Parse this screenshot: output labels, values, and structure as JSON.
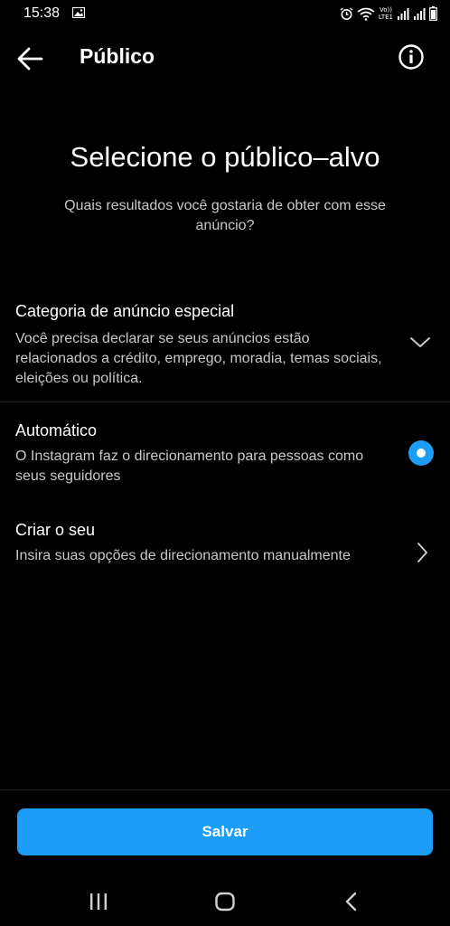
{
  "status_bar": {
    "time": "15:38",
    "volte_top": "Vo))",
    "volte_bottom": "LTE1"
  },
  "app_bar": {
    "title": "Público",
    "back_icon": "arrow-left-icon",
    "info_icon": "info-icon"
  },
  "header": {
    "title": "Selecione o público–alvo",
    "subtitle": "Quais resultados você gostaria de obter com esse anúncio?"
  },
  "options": {
    "special": {
      "title": "Categoria de anúncio especial",
      "description": "Você precisa declarar se seus anúncios estão relacionados a crédito, emprego, moradia, temas sociais, eleições ou política.",
      "icon": "chevron-down-icon"
    },
    "automatic": {
      "title": "Automático",
      "description": "O Instagram faz o direcionamento para pessoas como seus seguidores",
      "selected": true
    },
    "custom": {
      "title": "Criar o seu",
      "description": "Insira suas opções de direcionamento manualmente",
      "icon": "chevron-right-icon"
    }
  },
  "footer": {
    "save_label": "Salvar"
  },
  "colors": {
    "accent": "#1a9cf7",
    "background": "#000000",
    "secondary_text": "#c8c8c8"
  }
}
